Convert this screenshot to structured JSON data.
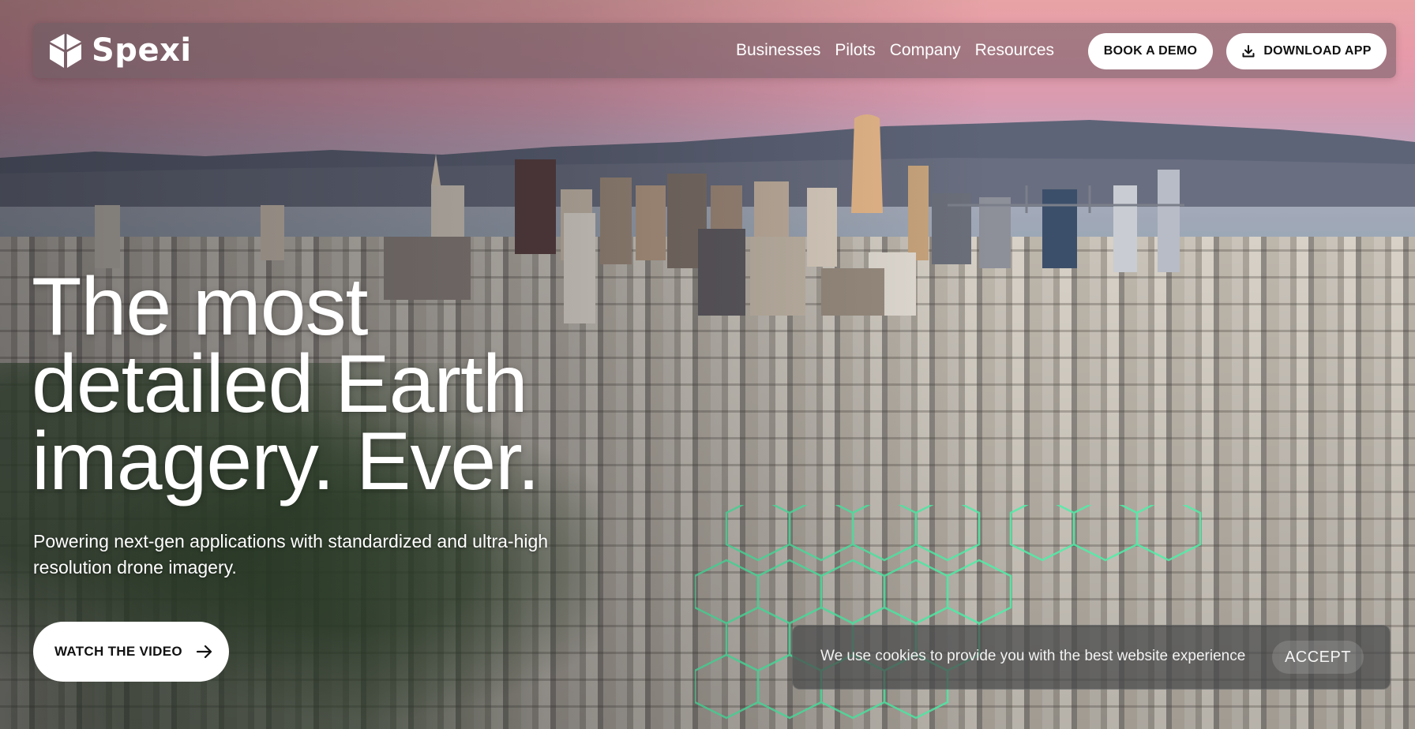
{
  "brand": {
    "name": "Spexi",
    "logo_icon": "cube-icon"
  },
  "nav": {
    "links": [
      "Businesses",
      "Pilots",
      "Company",
      "Resources"
    ],
    "book_demo": "BOOK A DEMO",
    "download_app": "DOWNLOAD APP",
    "download_icon": "download-icon"
  },
  "hero": {
    "title_lines": [
      "The most",
      "detailed Earth",
      "imagery. Ever."
    ],
    "subtitle": "Powering next-gen applications with standardized and ultra-high resolution drone imagery.",
    "video_button": "WATCH THE VIDEO",
    "video_icon": "arrow-right-icon"
  },
  "cookie_banner": {
    "message": "We use cookies to provide you with the best website experience",
    "accept": "ACCEPT"
  },
  "colors": {
    "sky_top": "#e7a3a6",
    "nav_bar": "#6e5c64",
    "button_bg": "#ffffff",
    "button_text": "#111111",
    "hex_overlay": "#4ff0a8"
  }
}
